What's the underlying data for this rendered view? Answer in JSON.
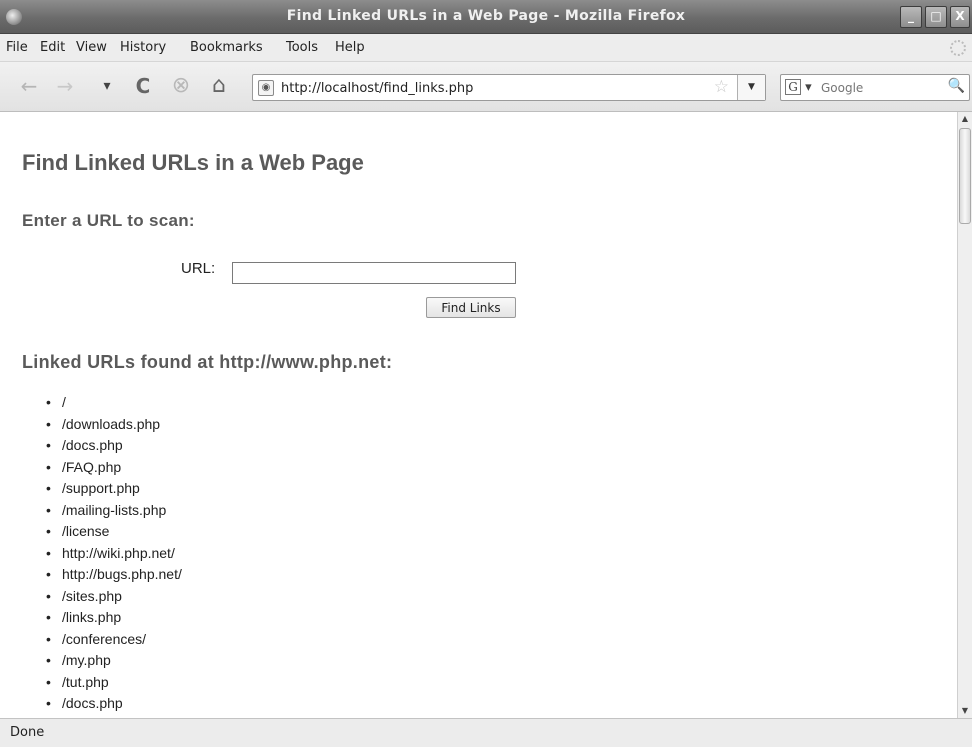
{
  "window": {
    "title": "Find Linked URLs in a Web Page - Mozilla Firefox",
    "minimize_glyph": "_",
    "maximize_glyph": "□",
    "close_glyph": "X"
  },
  "menu": {
    "items": [
      "File",
      "Edit",
      "View",
      "History",
      "Bookmarks",
      "Tools",
      "Help"
    ]
  },
  "toolbar": {
    "back_icon": "←",
    "forward_icon": "→",
    "history_dropdown_icon": "▾",
    "reload_icon": "C",
    "stop_icon": "⊗",
    "home_icon": "⌂",
    "url": "http://localhost/find_links.php",
    "bookmark_star": "☆",
    "url_dropdown": "▼",
    "search_engine": "G",
    "search_engine_dropdown": "▾",
    "search_placeholder": "Google",
    "search_go_icon": "🔍"
  },
  "page": {
    "title": "Find Linked URLs in a Web Page",
    "scan_heading": "Enter a URL to scan:",
    "url_label": "URL:",
    "url_value": "",
    "find_button": "Find Links",
    "results_heading": "Linked URLs found at http://www.php.net:",
    "links": [
      "/",
      "/downloads.php",
      "/docs.php",
      "/FAQ.php",
      "/support.php",
      "/mailing-lists.php",
      "/license",
      "http://wiki.php.net/",
      "http://bugs.php.net/",
      "/sites.php",
      "/links.php",
      "/conferences/",
      "/my.php",
      "/tut.php",
      "/docs.php"
    ]
  },
  "scrollbar": {
    "up_arrow": "▲",
    "down_arrow": "▼"
  },
  "status": {
    "text": "Done"
  }
}
